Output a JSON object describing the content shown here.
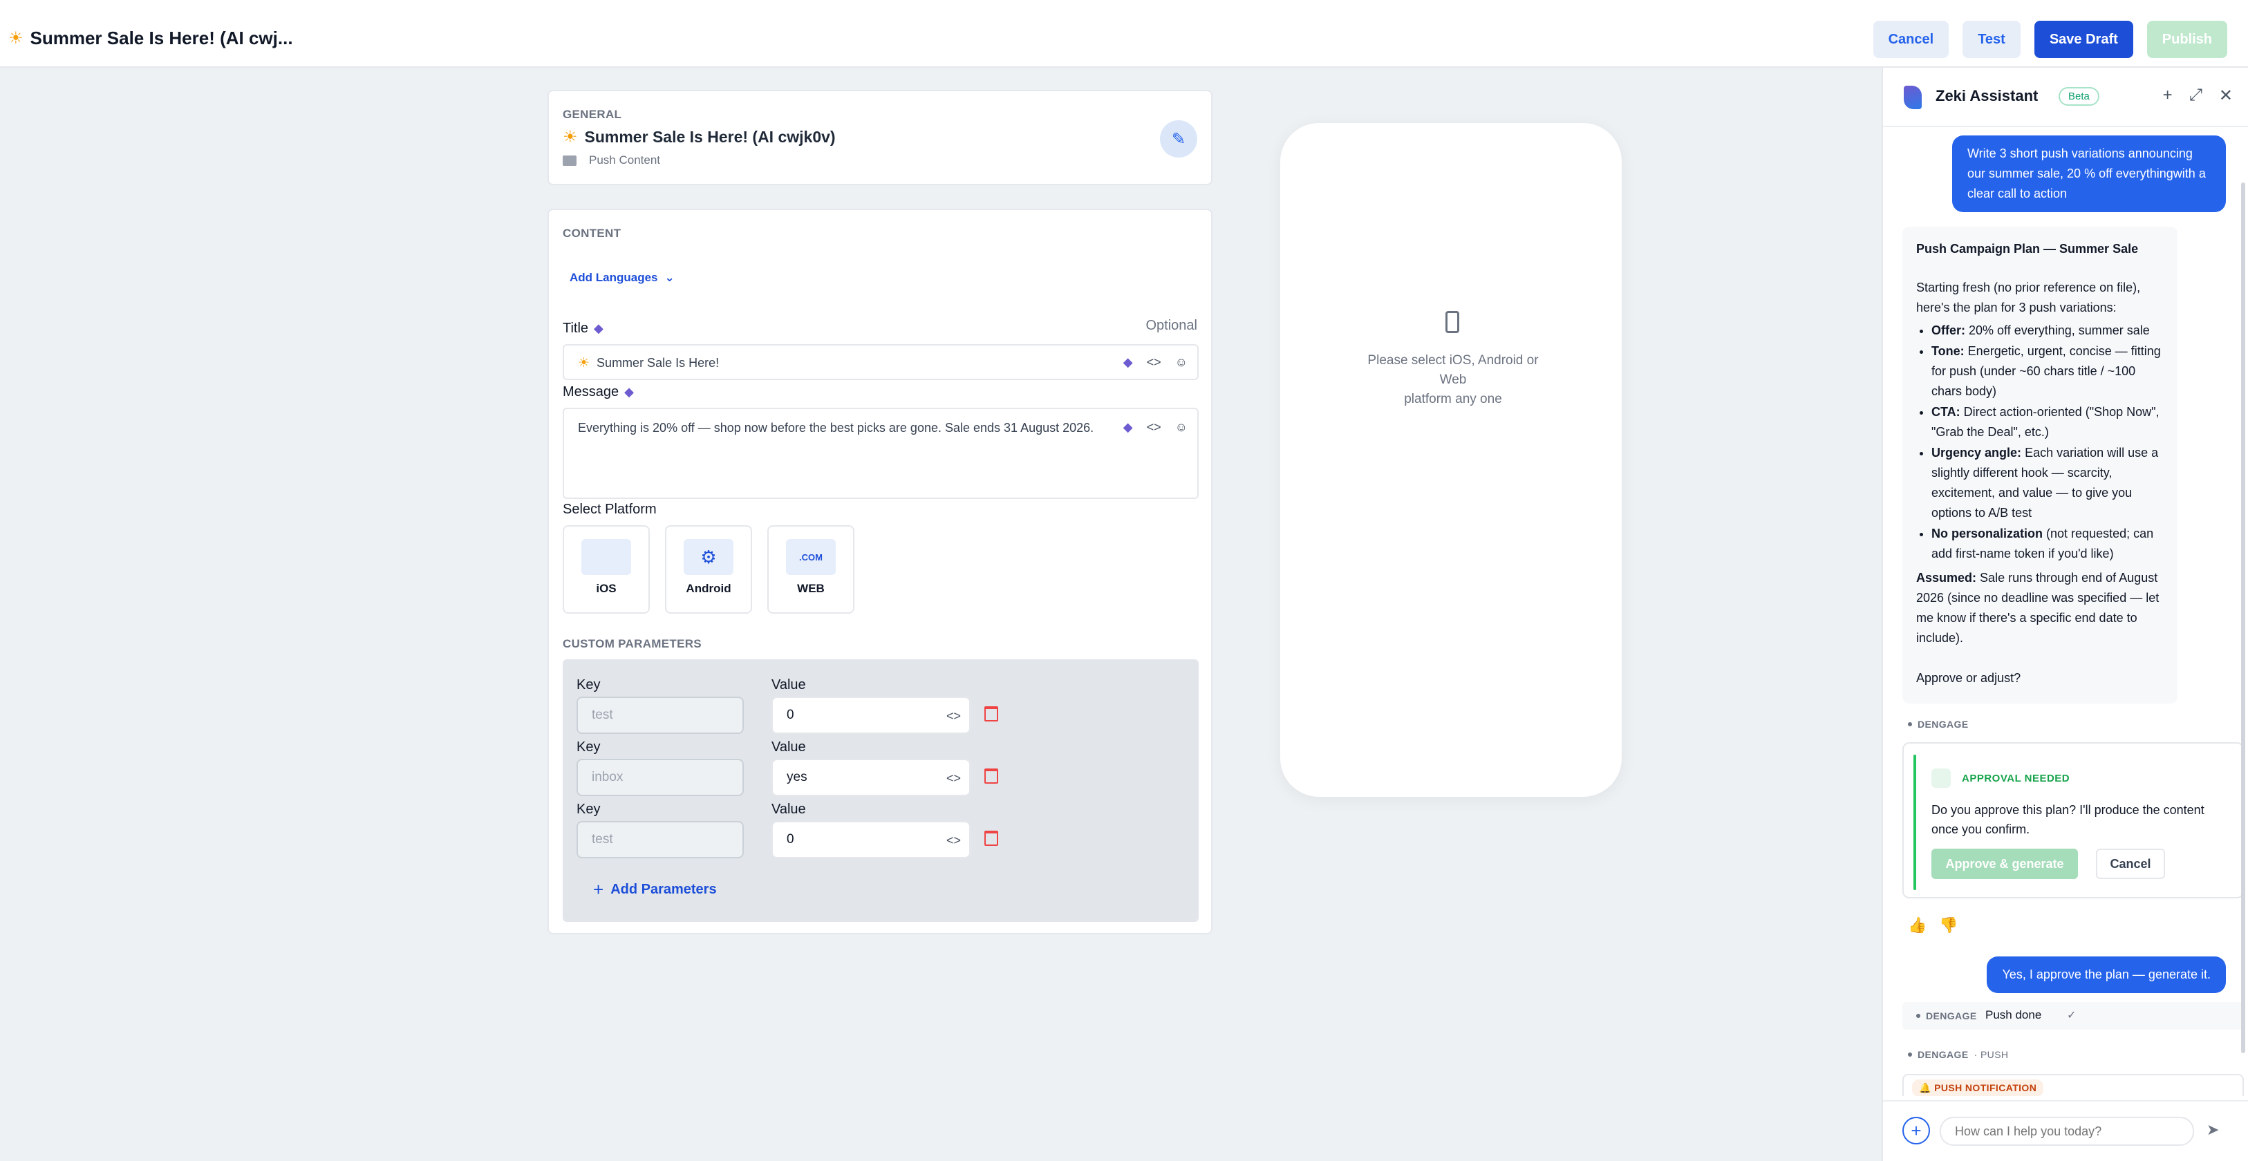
{
  "header": {
    "title": "Summer Sale Is Here! (AI cwj...",
    "cancel_label": "Cancel",
    "test_label": "Test",
    "save_draft_label": "Save Draft",
    "publish_label": "Publish"
  },
  "general": {
    "section_label": "GENERAL",
    "name": "Summer Sale Is Here! (AI cwjk0v)",
    "folder": "Push Content"
  },
  "content": {
    "section_label": "CONTENT",
    "add_languages_label": "Add Languages",
    "title_label": "Title",
    "optional_label": "Optional",
    "title_value": "Summer Sale Is Here!",
    "message_label": "Message",
    "message_value": "Everything is 20% off — shop now before the best picks are gone. Sale ends 31 August 2026.",
    "select_platform_label": "Select Platform",
    "platforms": [
      {
        "label": "iOS",
        "icon": "apple-icon"
      },
      {
        "label": "Android",
        "icon": "android-icon"
      },
      {
        "label": "WEB",
        "icon": "web-icon",
        "icon_text": ".COM"
      }
    ]
  },
  "custom_parameters": {
    "section_label": "CUSTOM PARAMETERS",
    "key_label": "Key",
    "value_label": "Value",
    "rows": [
      {
        "key_placeholder": "test",
        "value": "0"
      },
      {
        "key_placeholder": "inbox",
        "value": "yes"
      },
      {
        "key_placeholder": "test",
        "value": "0"
      }
    ],
    "add_label": "Add Parameters"
  },
  "preview": {
    "message_line1": "Please select iOS, Android or",
    "message_line2": "Web",
    "message_line3": "platform any one"
  },
  "assistant": {
    "title": "Zeki Assistant",
    "badge": "Beta",
    "user_message_1": "Write 3 short push variations announcing our summer sale, 20 % off everythingwith a clear call to action",
    "plan": {
      "heading": "Push Campaign Plan — Summer Sale",
      "intro": "Starting fresh (no prior reference on file), here's the plan for 3 push variations:",
      "bullets": [
        {
          "label": "Offer:",
          "text": "20% off everything, summer sale"
        },
        {
          "label": "Tone:",
          "text": "Energetic, urgent, concise — fitting for push (under ~60 chars title / ~100 chars body)"
        },
        {
          "label": "CTA:",
          "text": "Direct action-oriented (\"Shop Now\", \"Grab the Deal\", etc.)"
        },
        {
          "label": "Urgency angle:",
          "text": "Each variation will use a slightly different hook — scarcity, excitement, and value — to give you options to A/B test"
        },
        {
          "label": "No personalization",
          "text": "(not requested; can add first-name token if you'd like)"
        }
      ],
      "assumed_label": "Assumed:",
      "assumed_text": "Sale runs through end of August 2026 (since no deadline was specified — let me know if there's a specific end date to include).",
      "closing": "Approve or adjust?"
    },
    "tag_dengage": "DENGAGE",
    "approval": {
      "header": "APPROVAL NEEDED",
      "question": "Do you approve this plan? I'll produce the content once you confirm.",
      "approve_label": "Approve & generate",
      "cancel_label": "Cancel"
    },
    "user_message_2": "Yes, I approve the plan — generate it.",
    "push_done": "Push done",
    "tag_push": "· PUSH",
    "push_notification_label": "PUSH NOTIFICATION",
    "input_placeholder": "How can I help you today?"
  }
}
